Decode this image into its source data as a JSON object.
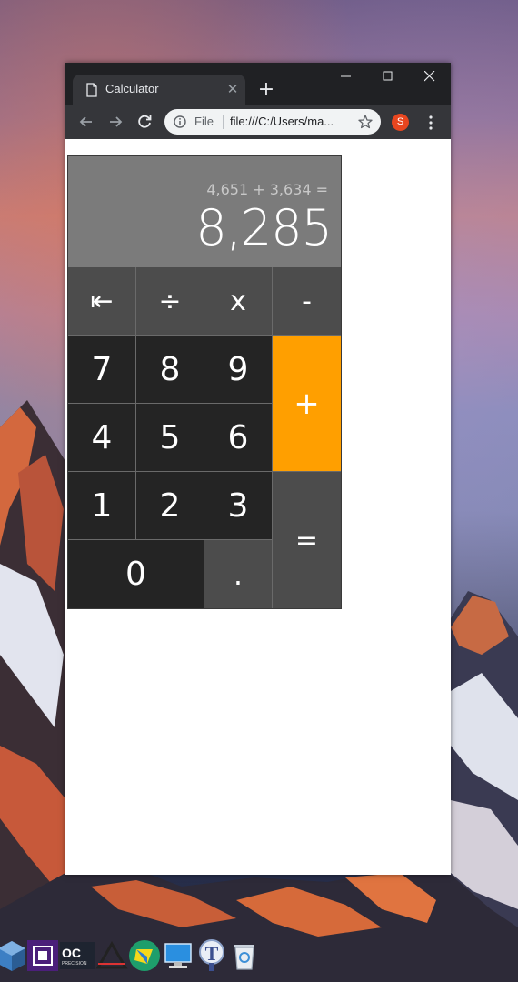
{
  "browser": {
    "tab_title": "Calculator",
    "tab_close_glyph": "✕",
    "new_tab_glyph": "+",
    "omnibox": {
      "scheme": "File",
      "url": "file:///C:/Users/ma..."
    },
    "avatar_letter": "S",
    "icons": [
      "page-icon",
      "minimize-icon",
      "maximize-icon",
      "close-icon",
      "back-arrow-icon",
      "forward-arrow-icon",
      "reload-icon",
      "info-icon",
      "star-icon",
      "kebab-menu-icon"
    ]
  },
  "calculator": {
    "expression": "4,651 + 3,634 =",
    "result": "8,285",
    "keys": {
      "backspace": "⇤",
      "divide": "÷",
      "multiply": "x",
      "minus": "-",
      "seven": "7",
      "eight": "8",
      "nine": "9",
      "plus": "+",
      "four": "4",
      "five": "5",
      "six": "6",
      "one": "1",
      "two": "2",
      "three": "3",
      "equals": "=",
      "zero": "0",
      "decimal": "."
    },
    "colors": {
      "display_bg": "#7b7b7b",
      "operator_bg": "#4c4c4c",
      "digit_bg": "#242424",
      "accent": "#ff9f00"
    }
  },
  "taskbar": {
    "icons": [
      "virtualbox-icon",
      "cpu-chip-icon",
      "oc-precision-icon",
      "triangle-logo-icon",
      "green-cube-icon",
      "monitor-icon",
      "typora-icon",
      "recycle-bin-icon"
    ],
    "labels": {
      "oc_precision": "OC",
      "oc_precision_sub": "PRECISION"
    }
  }
}
